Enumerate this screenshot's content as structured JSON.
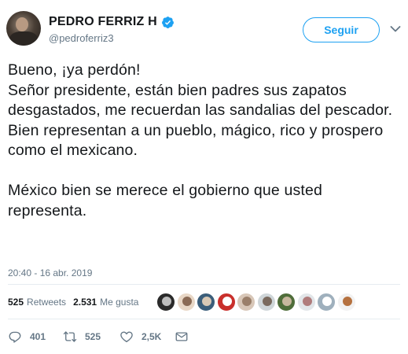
{
  "colors": {
    "accent": "#1da1f2",
    "text": "#14171a",
    "muted": "#657786",
    "divider": "#e6ecf0"
  },
  "author": {
    "display_name": "PEDRO FERRIZ H",
    "handle": "@pedroferriz3",
    "verified_icon": "verified-badge-icon",
    "avatar_icon": "avatar"
  },
  "header": {
    "follow_label": "Seguir",
    "menu_icon": "chevron-down-icon"
  },
  "tweet": {
    "text": "Bueno, ¡ya perdón!\nSeñor presidente, están bien padres sus zapatos desgastados, me recuerdan las sandalias del pescador.\nBien representan a un pueblo, mágico, rico y prospero como el mexicano.\n\nMéxico bien se merece el gobierno que usted representa.",
    "timestamp": "20:40 - 16 abr. 2019"
  },
  "stats": {
    "retweets_count": "525",
    "retweets_label": "Retweets",
    "likes_count": "2.531",
    "likes_label": "Me gusta"
  },
  "likers": [
    {
      "bg": "#2a2a2a",
      "fg": "#bdbdbd"
    },
    {
      "bg": "#e8d7c6",
      "fg": "#8a6a55"
    },
    {
      "bg": "#3b5e7a",
      "fg": "#d9c9b5"
    },
    {
      "bg": "#c9302c",
      "fg": "#ffffff"
    },
    {
      "bg": "#d8c7b8",
      "fg": "#9a7f6a"
    },
    {
      "bg": "#cfd6d9",
      "fg": "#7a6a5e"
    },
    {
      "bg": "#4f6d3a",
      "fg": "#c8b79e"
    },
    {
      "bg": "#e2e6e9",
      "fg": "#b07c7c"
    },
    {
      "bg": "#9fb0bd",
      "fg": "#ffffff"
    },
    {
      "bg": "#f2f2f2",
      "fg": "#b5713f"
    }
  ],
  "actions": {
    "reply_count": "401",
    "retweet_count": "525",
    "like_count": "2,5K",
    "reply_icon": "reply-icon",
    "retweet_icon": "retweet-icon",
    "like_icon": "heart-icon",
    "dm_icon": "envelope-icon"
  }
}
